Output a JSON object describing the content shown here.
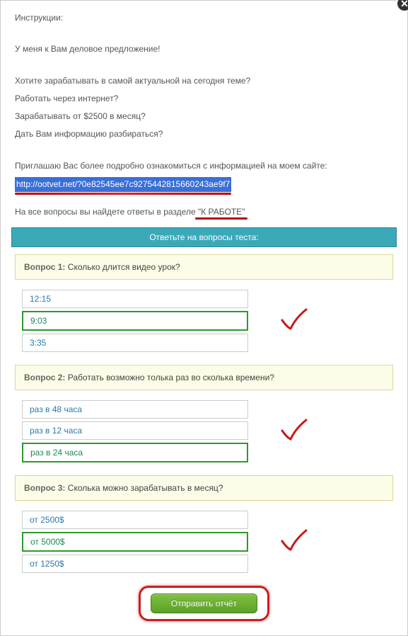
{
  "close_icon": "✕",
  "instructions": {
    "title": "Инструкции:",
    "line1": "У меня к Вам деловое предложение!",
    "line2": "Хотите зарабатывать в самой актуальной на сегодня теме?",
    "line3": "Работать через интернет?",
    "line4": "Зарабатывать от $2500 в месяц?",
    "line5": "Дать Вам информацию разбираться?",
    "invite": "Приглашаю Вас более подробно ознакомиться с информацией на моем сайте:",
    "link": "http://ootvet.net/?0e82545ee7c9275442815660243ae9f7",
    "footer_prefix": "На все вопросы вы найдете ответы в разделе ",
    "footer_section": "\"К РАБОТЕ\""
  },
  "test_header": "Ответьте на вопросы теста:",
  "questions": [
    {
      "label": "Вопрос 1:",
      "text": " Сколько длится видео урок?",
      "options": [
        "12:15",
        "9:03",
        "3:35"
      ],
      "selected": 1
    },
    {
      "label": "Вопрос 2:",
      "text": " Работать возможно толька раз во сколька времени?",
      "options": [
        "раз в 48 часа",
        "раз в 12 часа",
        "раз в 24 часа"
      ],
      "selected": 2
    },
    {
      "label": "Вопрос 3:",
      "text": " Сколька можно зарабатывать в месяц?",
      "options": [
        "от 2500$",
        "от 5000$",
        "от 1250$"
      ],
      "selected": 1
    }
  ],
  "submit_label": "Отправить отчёт"
}
